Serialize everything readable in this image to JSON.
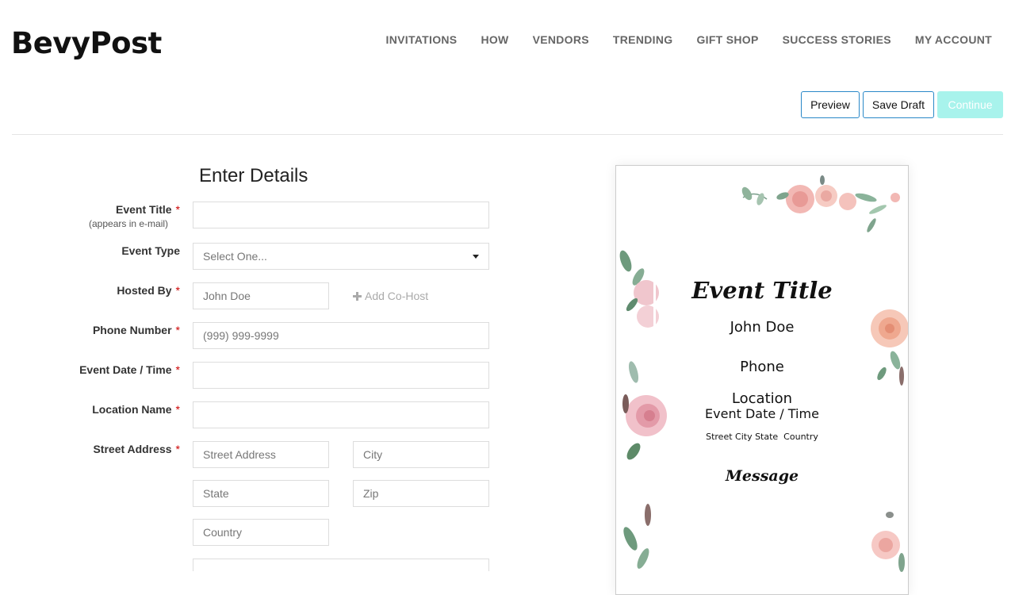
{
  "logo": "BevyPost",
  "nav": [
    "INVITATIONS",
    "HOW",
    "VENDORS",
    "TRENDING",
    "GIFT SHOP",
    "SUCCESS STORIES",
    "MY ACCOUNT"
  ],
  "actions": {
    "preview": "Preview",
    "save_draft": "Save Draft",
    "continue": "Continue"
  },
  "form": {
    "title": "Enter Details",
    "event_title": {
      "label": "Event Title",
      "sublabel": "(appears in e-mail)",
      "value": ""
    },
    "event_type": {
      "label": "Event Type",
      "selected": "Select One..."
    },
    "hosted_by": {
      "label": "Hosted By",
      "placeholder": "John Doe",
      "add_cohost": "Add Co-Host"
    },
    "phone": {
      "label": "Phone Number",
      "placeholder": "(999) 999-9999"
    },
    "event_date": {
      "label": "Event Date / Time",
      "value": ""
    },
    "location": {
      "label": "Location Name",
      "value": ""
    },
    "address": {
      "label": "Street Address",
      "street": "Street Address",
      "city": "City",
      "state": "State",
      "zip": "Zip",
      "country": "Country"
    },
    "required_mark": "*"
  },
  "preview_card": {
    "title": "Event Title",
    "host": "John Doe",
    "phone": "Phone",
    "location": "Location",
    "date": "Event Date / Time",
    "address": "Street City State  Country",
    "message": "Message"
  },
  "colors": {
    "accent": "#2a88c8",
    "continue_bg": "#a8f3ec",
    "required": "#cc0000"
  }
}
